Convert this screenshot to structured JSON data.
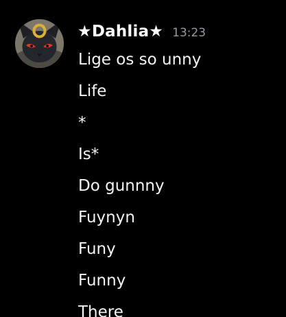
{
  "message": {
    "author": "★Dahlia★",
    "timestamp": "13:23",
    "avatar_icon": "umbreon-avatar-icon",
    "lines": [
      "Lige os so unny",
      "Life",
      "*",
      "Is*",
      "Do gunnny",
      "Fuynyn",
      "Funy",
      "Funny",
      "There"
    ]
  },
  "colors": {
    "background": "#000000",
    "text": "#f2f3f5",
    "timestamp": "#949ba4"
  }
}
